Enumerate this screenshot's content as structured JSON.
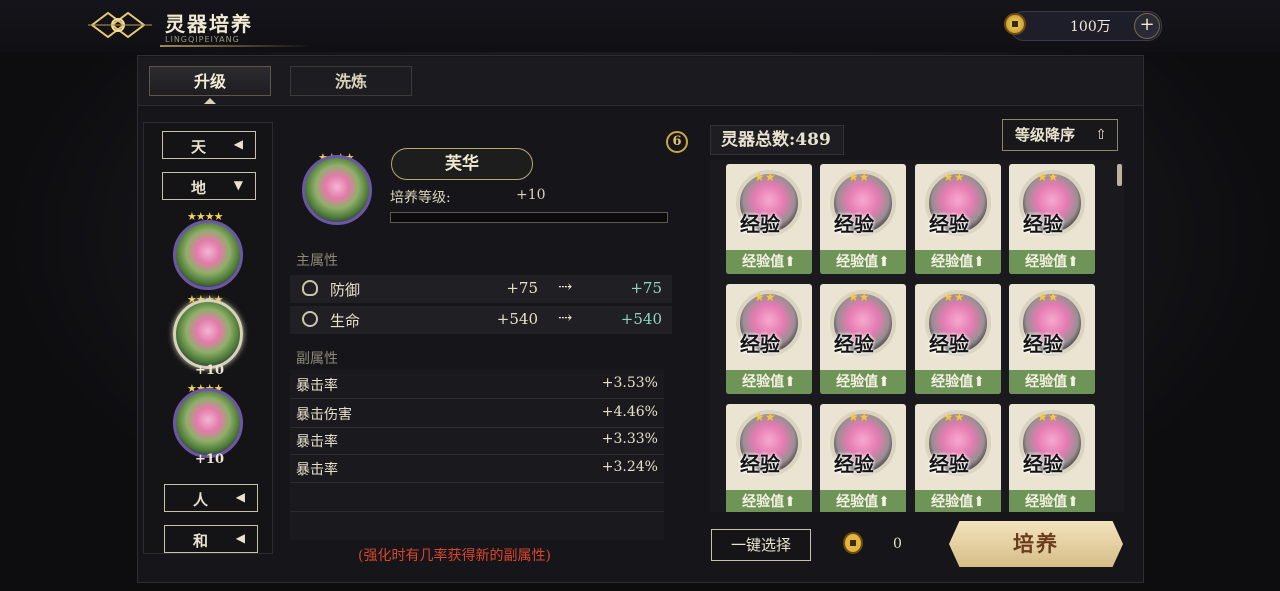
{
  "header": {
    "title": "灵器培养",
    "subtitle": "LINGQIPEIYANG",
    "currency_amount": "100万",
    "add_label": "+"
  },
  "tabs": [
    {
      "label": "升级",
      "active": true
    },
    {
      "label": "洗炼",
      "active": false
    }
  ],
  "filters": {
    "top": [
      {
        "label": "天",
        "arrow": "◀"
      },
      {
        "label": "地",
        "arrow": "▼"
      }
    ],
    "bottom": [
      {
        "label": "人",
        "arrow": "◀"
      },
      {
        "label": "和",
        "arrow": "◀"
      }
    ]
  },
  "item_list": [
    {
      "stars": "★★★★",
      "level": ""
    },
    {
      "stars": "★★★★",
      "level": "+10",
      "selected": true
    },
    {
      "stars": "★★★★",
      "level": "+10"
    }
  ],
  "detail": {
    "hero_stars": "★★★★",
    "name": "芙华",
    "level_label": "培养等级:",
    "level_value": "+10",
    "info_glyph": "6",
    "main_label": "主属性",
    "main_stats": [
      {
        "name": "防御",
        "from": "+75",
        "to": "+75",
        "icon": "shield-icon"
      },
      {
        "name": "生命",
        "from": "+540",
        "to": "+540",
        "icon": "heart-icon"
      }
    ],
    "sub_label": "副属性",
    "sub_stats": [
      {
        "name": "暴击率",
        "value": "+3.53%"
      },
      {
        "name": "暴击伤害",
        "value": "+4.46%"
      },
      {
        "name": "暴击率",
        "value": "+3.33%"
      },
      {
        "name": "暴击率",
        "value": "+3.24%"
      }
    ],
    "hint": "(强化时有几率获得新的副属性)"
  },
  "inventory": {
    "total_label": "灵器总数:",
    "total_count": "489",
    "sort_label": "等级降序",
    "card_text": "经验",
    "card_footer": "经验值⬆",
    "card_stars": "★★"
  },
  "footer": {
    "one_key_label": "一键选择",
    "cost": "0",
    "cultivate_label": "培养"
  },
  "colors": {
    "accent_gold": "#d6bd87",
    "exp_green": "#6f9458",
    "hint_red": "#d9452c",
    "stat_teal": "#8fd4c4"
  }
}
